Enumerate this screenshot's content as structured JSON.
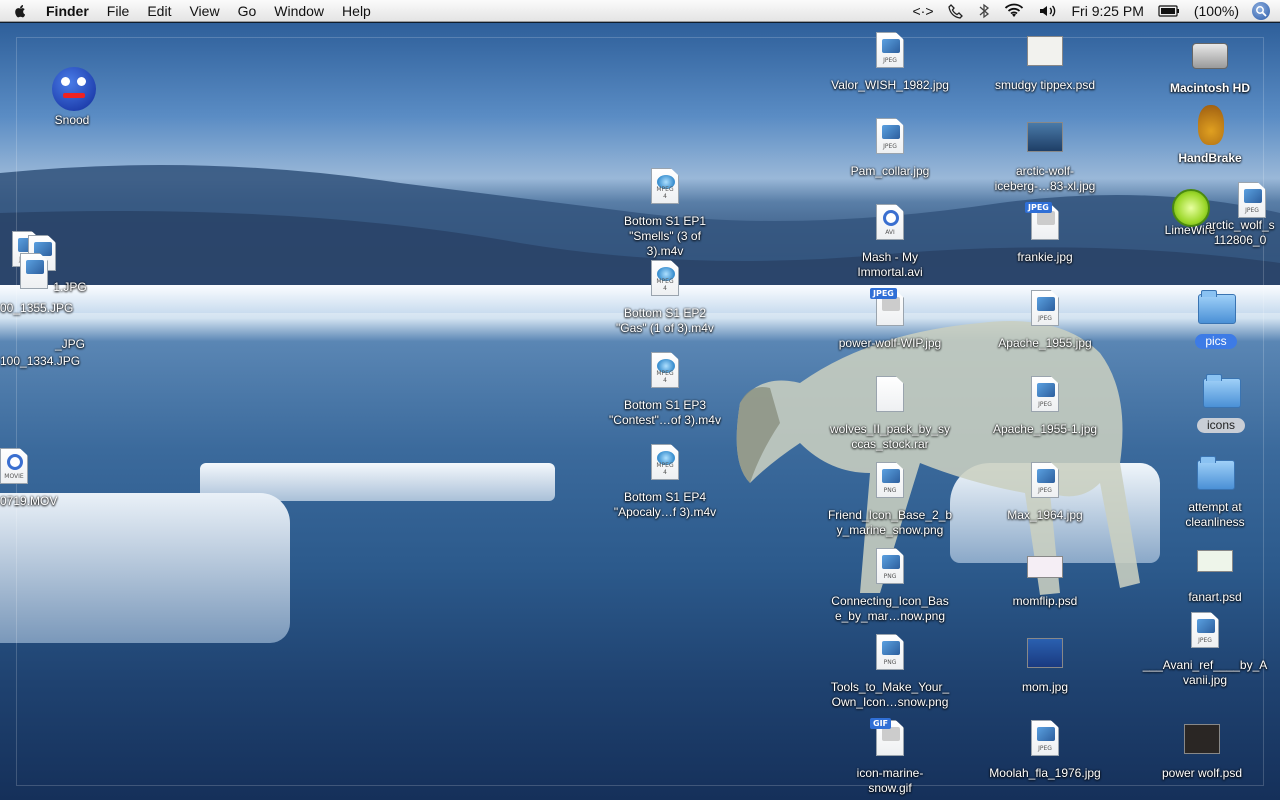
{
  "menubar": {
    "app_name": "Finder",
    "menus": [
      "File",
      "Edit",
      "View",
      "Go",
      "Window",
      "Help"
    ],
    "extras": {
      "sync": "<·>",
      "clock": "Fri 9:25 PM",
      "battery": "(100%)"
    },
    "icons": [
      "apple-icon",
      "phone-icon",
      "bluetooth-icon",
      "wifi-icon",
      "volume-icon",
      "battery-icon",
      "spotlight-icon"
    ]
  },
  "desktop": {
    "icons": [
      {
        "label": "Snood",
        "kind": "app"
      },
      {
        "label": "Valor_WISH_1982.jpg",
        "kind": "jpeg"
      },
      {
        "label": "smudgy tippex.psd",
        "kind": "psd"
      },
      {
        "label": "Macintosh HD",
        "kind": "disk"
      },
      {
        "label": "Pam_collar.jpg",
        "kind": "jpeg"
      },
      {
        "label": "arctic-wolf-iceberg-…83-xl.jpg",
        "kind": "jpeg"
      },
      {
        "label": "HandBrake",
        "kind": "app"
      },
      {
        "label": "Bottom S1 EP1 \"Smells\" (3 of 3).m4v",
        "kind": "mpeg4"
      },
      {
        "label": "Mash - My Immortal.avi",
        "kind": "avi"
      },
      {
        "label": "frankie.jpg",
        "kind": "jpeg"
      },
      {
        "label": "LimeWire",
        "kind": "app"
      },
      {
        "label": "arctic_wolf_s 112806_0",
        "kind": "jpeg"
      },
      {
        "label": "Bottom S1 EP2 \"Gas\" (1 of 3).m4v",
        "kind": "mpeg4"
      },
      {
        "label": "power-wolf-WIP.jpg",
        "kind": "jpeg"
      },
      {
        "label": "Apache_1955.jpg",
        "kind": "jpeg"
      },
      {
        "label": "pics",
        "kind": "folder"
      },
      {
        "label": "Bottom S1 EP3 \"Contest\"…of 3).m4v",
        "kind": "mpeg4"
      },
      {
        "label": "wolves_II_pack_by_sy ccas_stock.rar",
        "kind": "rar"
      },
      {
        "label": "Apache_1955-1.jpg",
        "kind": "jpeg"
      },
      {
        "label": "icons",
        "kind": "folder"
      },
      {
        "label": "Bottom S1 EP4 \"Apocaly…f 3).m4v",
        "kind": "mpeg4"
      },
      {
        "label": "Friend_Icon_Base_2_b y_marine_snow.png",
        "kind": "png"
      },
      {
        "label": "Max_1964.jpg",
        "kind": "jpeg"
      },
      {
        "label": "attempt at cleanliness",
        "kind": "folder"
      },
      {
        "label": "Connecting_Icon_Bas e_by_mar…now.png",
        "kind": "png"
      },
      {
        "label": "momflip.psd",
        "kind": "psd"
      },
      {
        "label": "fanart.psd",
        "kind": "psd"
      },
      {
        "label": "Tools_to_Make_Your_ Own_Icon…snow.png",
        "kind": "png"
      },
      {
        "label": "mom.jpg",
        "kind": "jpeg"
      },
      {
        "label": "___Avani_ref____by_A vanii.jpg",
        "kind": "jpeg"
      },
      {
        "label": "icon-marine- snow.gif",
        "kind": "gif"
      },
      {
        "label": "Moolah_fla_1976.jpg",
        "kind": "jpeg"
      },
      {
        "label": "power wolf.psd",
        "kind": "psd"
      },
      {
        "label": "100_1334.JPG",
        "kind": "jpeg"
      },
      {
        "label": "0719.MOV",
        "kind": "movie"
      }
    ],
    "stack_labels": [
      "1.JPG",
      "00_1355.JPG",
      "_JPG",
      "100_1334.JPG"
    ],
    "type_tags": {
      "jpeg": "JPEG",
      "mpeg4": "MPEG 4",
      "avi": "AVI",
      "png": "PNG",
      "gif": "GIF",
      "movie": "MOVIE"
    }
  }
}
